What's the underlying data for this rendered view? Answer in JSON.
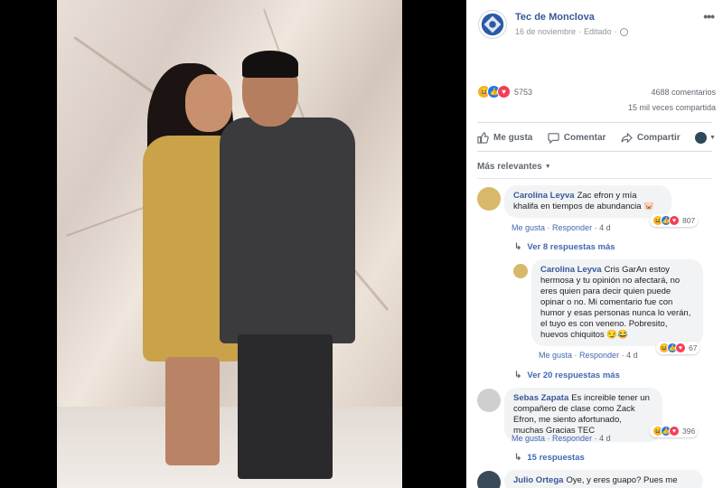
{
  "page": {
    "name": "Tec de Monclova",
    "date": "16 de noviembre",
    "edited": "Editado"
  },
  "stats": {
    "reactions": "5753",
    "comments": "4688 comentarios",
    "shares": "15 mil veces compartida"
  },
  "actions": {
    "like": "Me gusta",
    "comment": "Comentar",
    "share": "Compartir"
  },
  "sort_label": "Más relevantes",
  "comments": [
    {
      "author": "Carolina Leyva",
      "text": "Zac efron y mía khalifa en tiempos de abundancia 🐷",
      "like": "Me gusta",
      "reply": "Responder",
      "time": "4 d",
      "reactions": "807",
      "replies": "Ver 8 respuestas más"
    },
    {
      "author": "Carolina Leyva",
      "text": "Cris GarAn estoy hermosa y tu opinión no afectará, no eres quien para decir quien puede opinar o no. Mi comentario fue con humor y esas personas nunca lo verán, el tuyo es con veneno. Pobresito, huevos chiquitos 😏😂",
      "like": "Me gusta",
      "reply": "Responder",
      "time": "4 d",
      "reactions": "67",
      "replies": "Ver 20 respuestas más"
    },
    {
      "author": "Sebas Zapata",
      "text": "Es increible tener un compañero de clase como Zack Efron, me siento afortunado, muchas Gracias TEC",
      "like": "Me gusta",
      "reply": "Responder",
      "time": "4 d",
      "reactions": "396",
      "replies": "15 respuestas"
    },
    {
      "author": "Julio Ortega",
      "text": "Oye, y eres guapo? Pues me"
    }
  ],
  "colors": {
    "link": "#385898",
    "bubble": "#f2f3f5",
    "like_blue": "#1877f2",
    "love_red": "#f33e58",
    "haha_yellow": "#f7b125"
  }
}
